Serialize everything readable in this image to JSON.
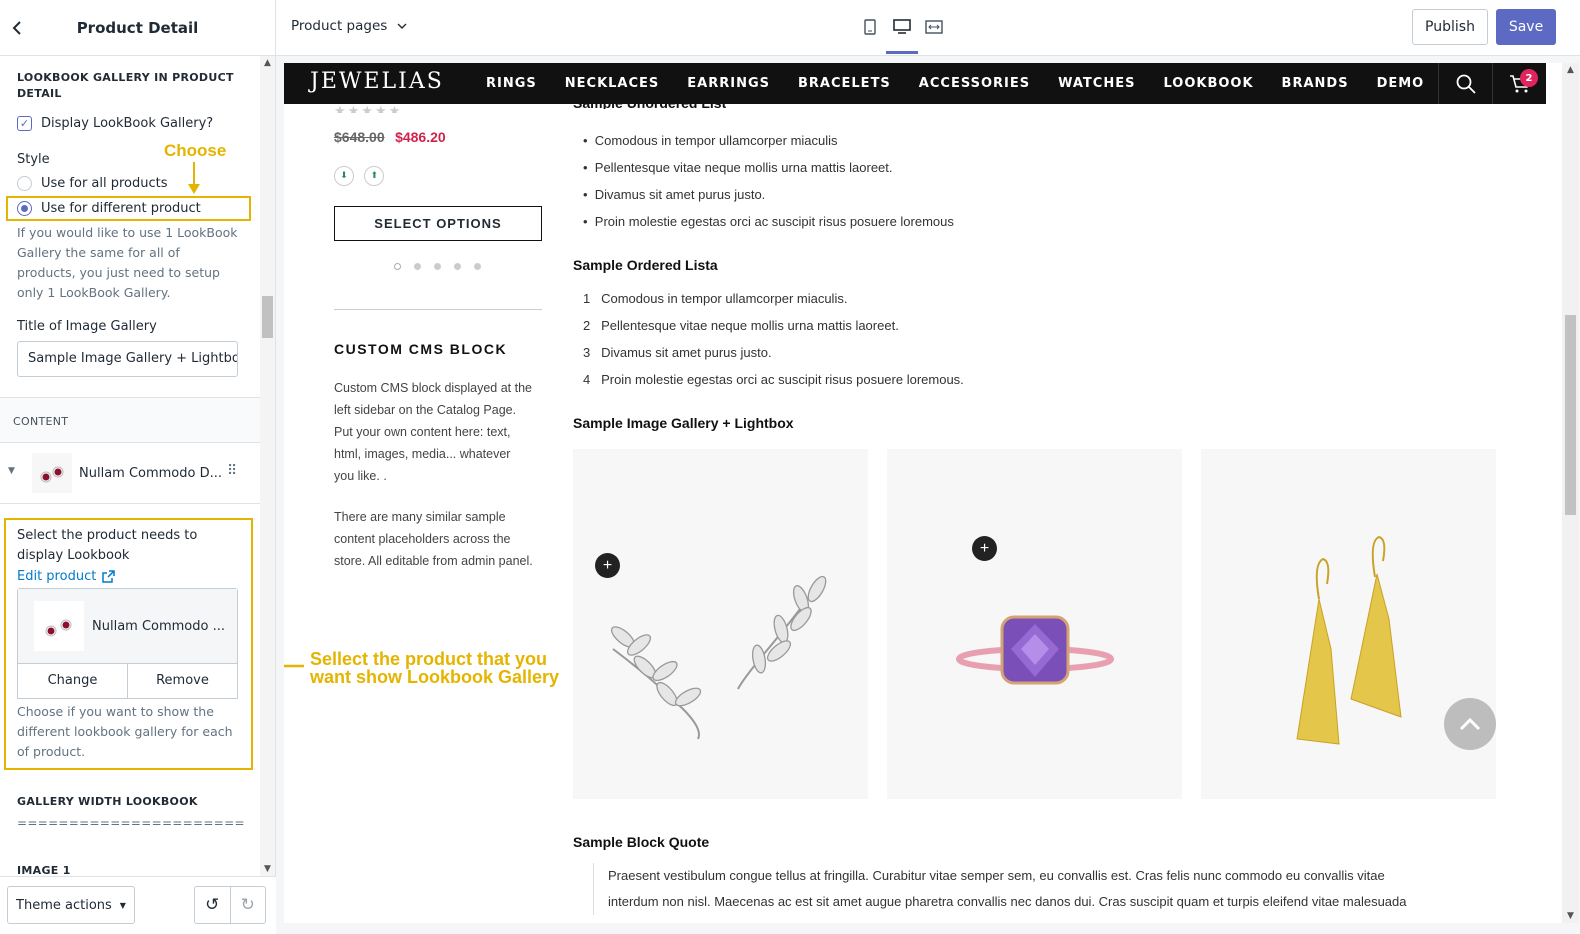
{
  "sidebar": {
    "title": "Product Detail",
    "section_heading": "LOOKBOOK GALLERY IN PRODUCT DETAIL",
    "display_checkbox_label": "Display LookBook Gallery?",
    "style_label": "Style",
    "radio_all": "Use for all products",
    "radio_different": "Use for different product",
    "style_help": "If you would like to use 1 LookBook Gallery the same for all of products, you just need to setup only 1 LookBook Gallery.",
    "gallery_title_label": "Title of Image Gallery",
    "gallery_title_value": "Sample Image Gallery + Lightbox",
    "content_heading": "CONTENT",
    "content_item": "Nullam Commodo D...",
    "select_product_label": "Select the product needs to display Lookbook",
    "edit_product_link": "Edit product",
    "selected_product": "Nullam Commodo ...",
    "change_button": "Change",
    "remove_button": "Remove",
    "product_help": "Choose if you want to show the different lookbook gallery for each of product.",
    "gallery_width_heading": "GALLERY WIDTH LOOKBOOK",
    "gallery_width_rule": "======================",
    "image_heading": "IMAGE 1",
    "theme_actions": "Theme actions"
  },
  "annotations": {
    "choose": "Choose",
    "select_line1": "Sellect the product that you",
    "select_line2": "want show Lookbook Gallery",
    "color": "#e5b400"
  },
  "topbar": {
    "page_select": "Product pages",
    "publish": "Publish",
    "save": "Save",
    "accent": "#5c6ac4"
  },
  "store": {
    "logo": "JEWELIAS",
    "nav": [
      "RINGS",
      "NECKLACES",
      "EARRINGS",
      "BRACELETS",
      "ACCESSORIES",
      "WATCHES",
      "LOOKBOOK",
      "BRANDS",
      "DEMO"
    ],
    "cart_count": "2",
    "price_old": "$648.00",
    "price_new": "$486.20",
    "select_options": "SELECT OPTIONS",
    "cms_title": "CUSTOM CMS BLOCK",
    "cms_p1": "Custom CMS block displayed at the left sidebar on the Catalog Page. Put your own content here: text, html, images, media... whatever you like. .",
    "cms_p2": "There are many similar sample content placeholders across the store. All editable from admin panel.",
    "unordered_heading": "Sample Unordered List",
    "unordered": [
      "Comodous in tempor ullamcorper miaculis",
      "Pellentesque vitae neque mollis urna mattis laoreet.",
      "Divamus sit amet purus justo.",
      "Proin molestie egestas orci ac suscipit risus posuere loremous"
    ],
    "ordered_heading": "Sample Ordered Lista",
    "ordered_numbers": [
      "1",
      "2",
      "3",
      "4"
    ],
    "ordered": [
      "Comodous in tempor ullamcorper miaculis.",
      "Pellentesque vitae neque mollis urna mattis laoreet.",
      "Divamus sit amet purus justo.",
      "Proin molestie egestas orci ac suscipit risus posuere loremous."
    ],
    "gallery_heading": "Sample Image Gallery + Lightbox",
    "quote_heading": "Sample Block Quote",
    "quote_line1": "Praesent vestibulum congue tellus at fringilla. Curabitur vitae semper sem, eu convallis est. Cras felis nunc commodo eu convallis vitae",
    "quote_line2": "interdum non nisl. Maecenas ac est sit amet augue pharetra convallis nec danos dui. Cras suscipit quam et turpis eleifend vitae malesuada"
  }
}
